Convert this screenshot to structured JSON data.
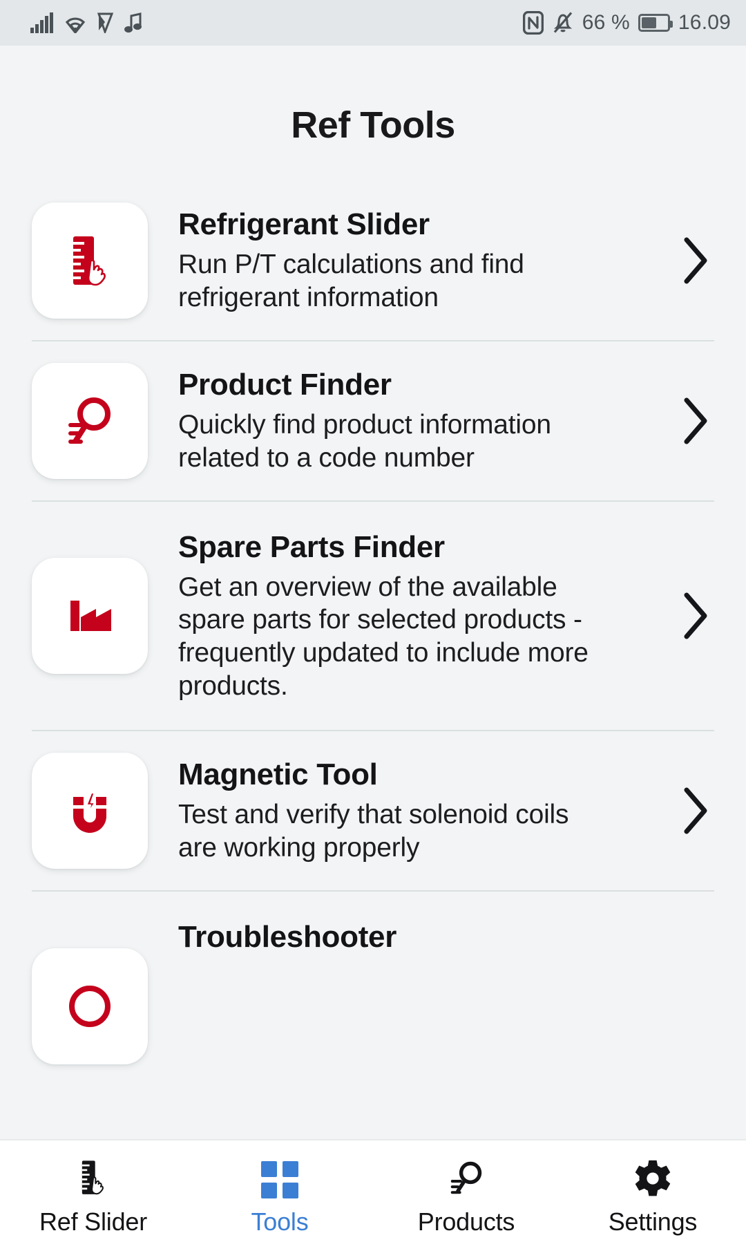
{
  "status_bar": {
    "left_icons": [
      "signal-bars-icon",
      "wifi-icon",
      "play-store-icon",
      "music-note-icon"
    ],
    "nfc_icon": "nfc-icon",
    "mute_icon": "bell-off-icon",
    "battery_percent": "66 %",
    "battery_icon": "battery-icon",
    "time": "16.09"
  },
  "header": {
    "title": "Ref Tools"
  },
  "colors": {
    "brand_red": "#c4021c",
    "accent_blue": "#3b7fd4",
    "background": "#f2f4f5",
    "card": "#ffffff",
    "text": "#141416",
    "separator": "#dadfe0",
    "statusbar_bg": "#e3e7e9"
  },
  "tools": [
    {
      "icon": "ruler-hand-icon",
      "title": "Refrigerant Slider",
      "description": "Run P/T calculations and find refrigerant information",
      "chevron": "chevron-right-icon"
    },
    {
      "icon": "magnifier-list-icon",
      "title": "Product Finder",
      "description": "Quickly find product information related to a code number",
      "chevron": "chevron-right-icon"
    },
    {
      "icon": "factory-icon",
      "title": "Spare Parts Finder",
      "description": "Get an overview of the available spare parts for selected products - frequently updated to include more products.",
      "chevron": "chevron-right-icon"
    },
    {
      "icon": "magnet-icon",
      "title": "Magnetic Tool",
      "description": "Test and verify that solenoid coils are working properly",
      "chevron": "chevron-right-icon"
    },
    {
      "icon": "troubleshooter-icon",
      "title": "Troubleshooter",
      "description": "",
      "chevron": "chevron-right-icon"
    }
  ],
  "tabbar": {
    "items": [
      {
        "icon": "ruler-hand-icon",
        "label": "Ref Slider",
        "active": false
      },
      {
        "icon": "grid-squares-icon",
        "label": "Tools",
        "active": true
      },
      {
        "icon": "magnifier-list-icon",
        "label": "Products",
        "active": false
      },
      {
        "icon": "gear-icon",
        "label": "Settings",
        "active": false
      }
    ]
  }
}
